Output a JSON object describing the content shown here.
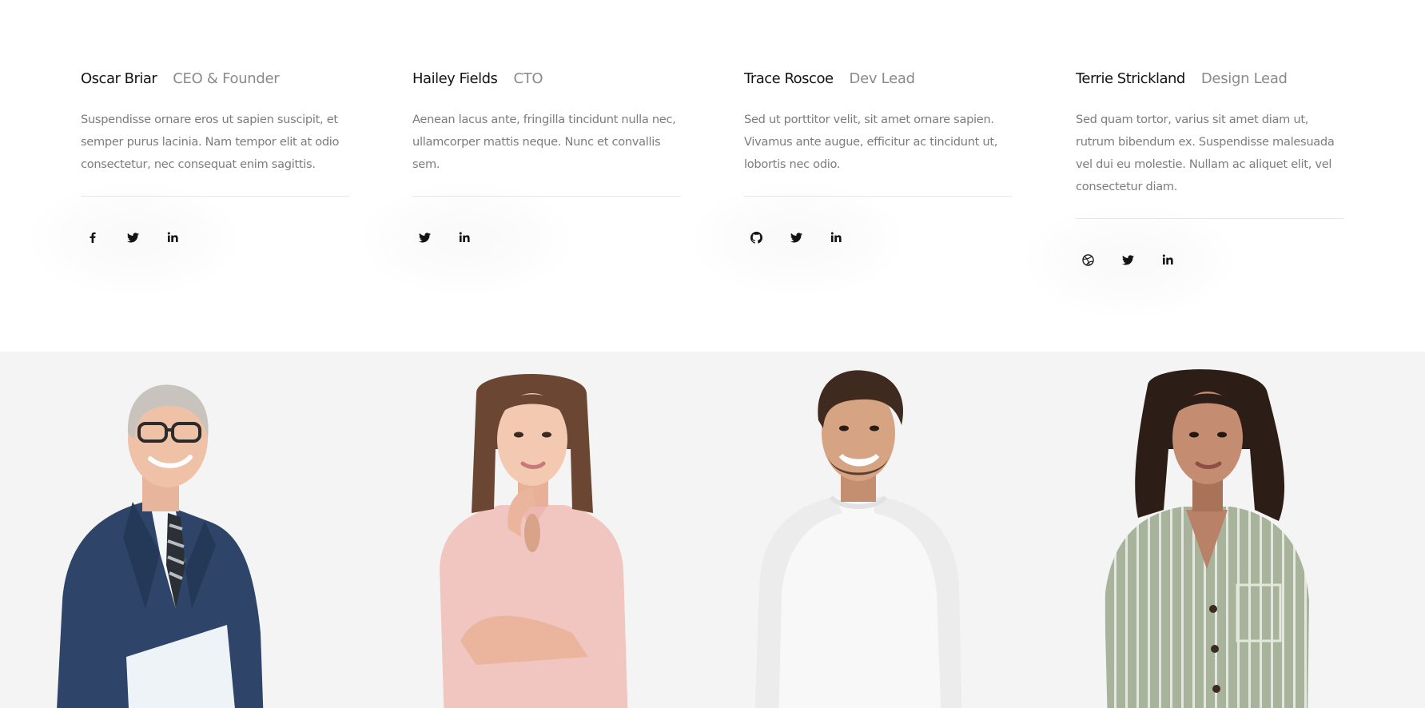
{
  "team": [
    {
      "name": "Oscar Briar",
      "role": "CEO & Founder",
      "bio": "Suspendisse ornare eros ut sapien suscipit, et semper purus lacinia. Nam tempor elit at odio consectetur, nec consequat enim sagittis.",
      "socials": [
        "facebook-icon",
        "twitter-icon",
        "linkedin-icon"
      ]
    },
    {
      "name": "Hailey Fields",
      "role": "CTO",
      "bio": "Aenean lacus ante, fringilla tincidunt nulla nec, ullamcorper mattis neque. Nunc et convallis sem.",
      "socials": [
        "twitter-icon",
        "linkedin-icon"
      ]
    },
    {
      "name": "Trace Roscoe",
      "role": "Dev Lead",
      "bio": "Sed ut porttitor velit, sit amet ornare sapien. Vivamus ante augue, efficitur ac tincidunt ut, lobortis nec odio.",
      "socials": [
        "github-icon",
        "twitter-icon",
        "linkedin-icon"
      ]
    },
    {
      "name": "Terrie Strickland",
      "role": "Design Lead",
      "bio": "Sed quam tortor, varius sit amet diam ut, rutrum bibendum ex. Suspendisse malesuada vel dui eu molestie. Nullam ac aliquet elit, vel consectetur diam.",
      "socials": [
        "dribbble-icon",
        "twitter-icon",
        "linkedin-icon"
      ]
    }
  ],
  "colors": {
    "text_dark": "#141414",
    "text_muted": "#8a8a8a",
    "body_text": "#7c7c7c",
    "divider": "#e8e8e8",
    "photo_background": "#f4f4f4"
  }
}
